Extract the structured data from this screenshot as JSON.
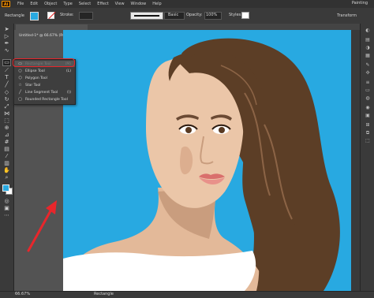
{
  "app": {
    "logo": "Ai",
    "workspace": "Painting"
  },
  "menu": [
    "File",
    "Edit",
    "Object",
    "Type",
    "Select",
    "Effect",
    "View",
    "Window",
    "Help"
  ],
  "control_bar": {
    "selection_label": "Rectangle",
    "stroke_label": "Stroke:",
    "stroke_profile": "Basic",
    "opacity_label": "Opacity:",
    "opacity_value": "100%",
    "styles_label": "Styles:",
    "transform_label": "Transform",
    "fill_color": "#29a9e0"
  },
  "document": {
    "tab_title": "Untitled-1* @ 66.67% (RGB/Preview)",
    "zoom": "66.67%"
  },
  "toolbar_icons": [
    "selection-arrow-icon",
    "direct-selection-icon",
    "pen-icon",
    "curvature-icon",
    "rectangle-icon",
    "brush-icon",
    "pencil-icon",
    "type-icon",
    "line-icon",
    "shaper-icon",
    "eraser-icon",
    "rotate-icon",
    "scale-icon",
    "width-icon",
    "free-transform-icon",
    "shape-builder-icon",
    "perspective-icon",
    "mesh-icon",
    "gradient-icon",
    "eyedropper-icon",
    "blend-icon",
    "symbol-sprayer-icon",
    "graph-icon",
    "artboard-icon",
    "slice-icon",
    "hand-icon",
    "zoom-icon"
  ],
  "flyout": {
    "items": [
      {
        "label": "Rectangle Tool",
        "key": "(M)",
        "icon": "rectangle-tool-icon",
        "glyph": "▭"
      },
      {
        "label": "Ellipse Tool",
        "key": "(L)",
        "icon": "ellipse-tool-icon",
        "glyph": "○"
      },
      {
        "label": "Polygon Tool",
        "key": "",
        "icon": "polygon-tool-icon",
        "glyph": "⬡"
      },
      {
        "label": "Star Tool",
        "key": "",
        "icon": "star-tool-icon",
        "glyph": "☆"
      },
      {
        "label": "Line Segment Tool",
        "key": "(\\)",
        "icon": "line-segment-tool-icon",
        "glyph": "╱"
      },
      {
        "label": "Rounded Rectangle Tool",
        "key": "",
        "icon": "rounded-rectangle-tool-icon",
        "glyph": "▢"
      }
    ]
  },
  "status_bar": {
    "tool": "Rectangle"
  },
  "colors": {
    "canvas_background": "#28a9e1",
    "hair": "#5c3e26",
    "skin": "#e9c4a6",
    "highlight": "#e8262b"
  }
}
